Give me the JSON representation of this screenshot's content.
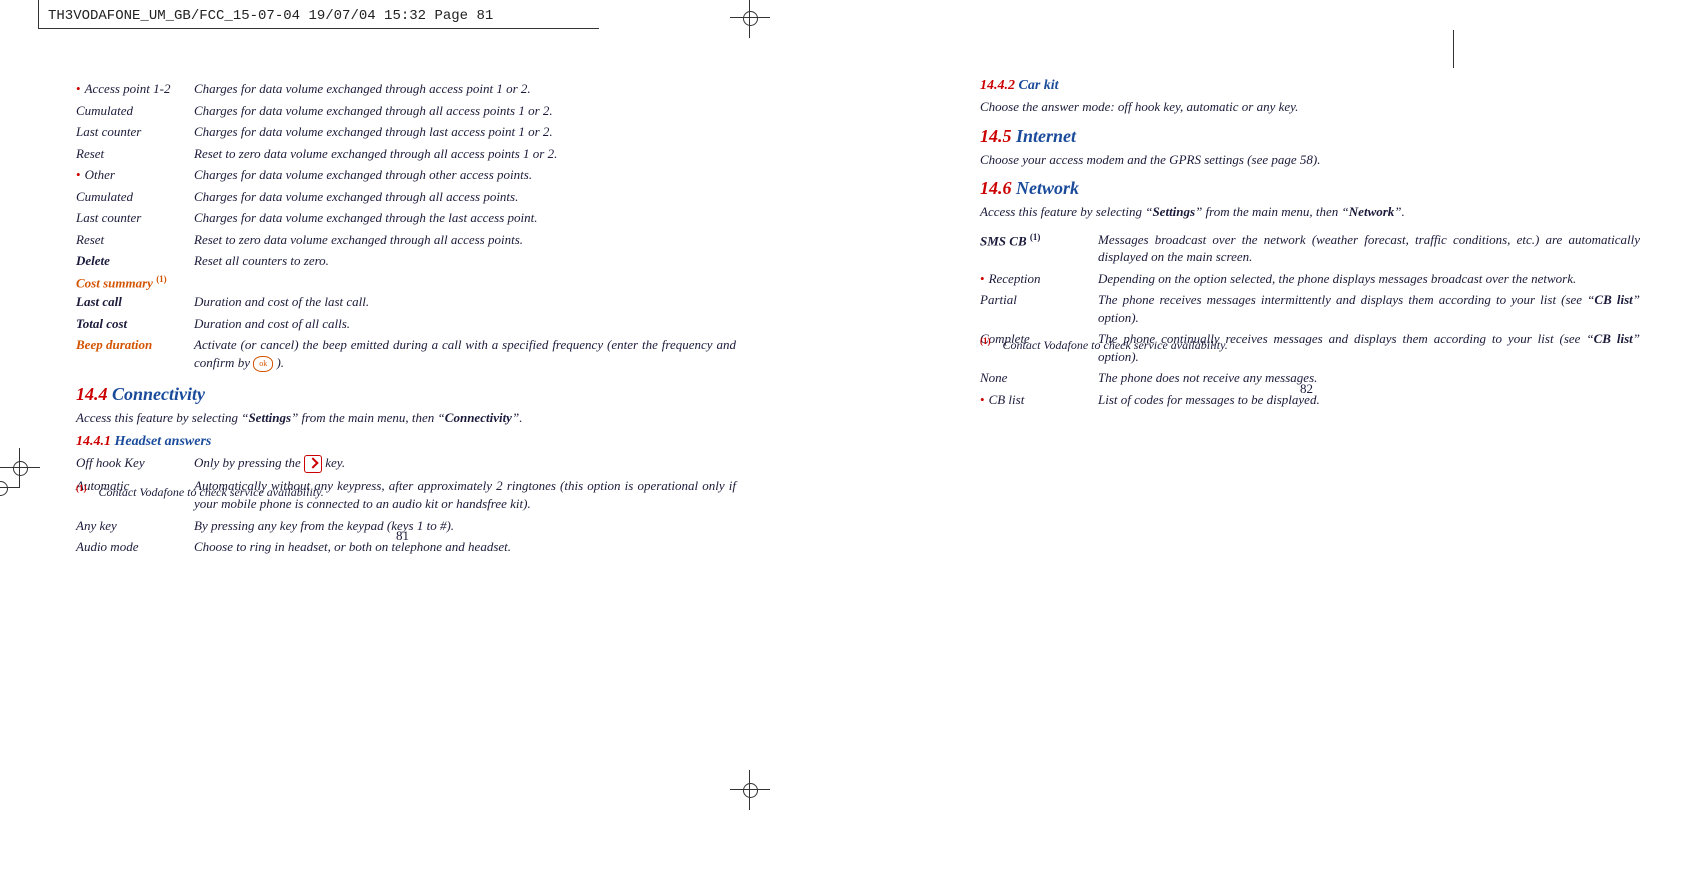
{
  "header": {
    "slug": "TH3VODAFONE_UM_GB/FCC_15-07-04   19/07/04   15:32   Page 81"
  },
  "left": {
    "rows": [
      {
        "term": "Access point 1-2",
        "bullet": true,
        "indent": 0,
        "desc": "Charges for data volume exchanged through access point 1 or 2."
      },
      {
        "term": "Cumulated",
        "bullet": false,
        "indent": 1,
        "desc": "Charges for data volume exchanged through all access points 1 or 2."
      },
      {
        "term": "Last counter",
        "bullet": false,
        "indent": 1,
        "desc": "Charges for data volume exchanged through last access point 1 or 2."
      },
      {
        "term": "Reset",
        "bullet": false,
        "indent": 1,
        "desc": "Reset to zero data volume exchanged through all access points 1 or 2."
      },
      {
        "term": "Other",
        "bullet": true,
        "indent": 0,
        "desc": "Charges for data volume exchanged through other access points."
      },
      {
        "term": "Cumulated",
        "bullet": false,
        "indent": 1,
        "desc": "Charges for data volume exchanged through all access points."
      },
      {
        "term": "Last counter",
        "bullet": false,
        "indent": 1,
        "desc": "Charges for data volume exchanged through the last access point."
      },
      {
        "term": "Reset",
        "bullet": false,
        "indent": 1,
        "desc": "Reset to zero data volume exchanged through all access points."
      },
      {
        "term": "Delete",
        "bold": true,
        "bullet": false,
        "indent": 0,
        "desc": "Reset all counters to zero."
      }
    ],
    "cost_heading": "Cost summary ",
    "cost_fn": "(1)",
    "cost": [
      {
        "term": "Last call",
        "desc": "Duration and cost of the last call."
      },
      {
        "term": "Total cost",
        "desc": "Duration and cost of all calls."
      }
    ],
    "beep_term": "Beep duration",
    "beep_desc_a": "Activate (or cancel) the beep emitted during a call with a specified frequency (enter the frequency and confirm by ",
    "beep_desc_b": " ).",
    "h144_num": "14.4 ",
    "h144_txt": "Connectivity",
    "p144_a": "Access this feature by selecting “",
    "p144_b": "Settings",
    "p144_c": "” from the main menu, then “",
    "p144_d": "Connectivity",
    "p144_e": "”.",
    "h1441_num": "14.4.1   ",
    "h1441_txt": "Headset answers",
    "headset": [
      {
        "term": "Off hook Key",
        "desc_a": "Only by pressing the ",
        "desc_b": " key.",
        "icon": "key"
      },
      {
        "term": "Automatic",
        "desc": "Automatically without any keypress, after approximately 2 ringtones (this option is operational only if your mobile phone is connected to an audio kit or handsfree kit)."
      },
      {
        "term": "Any key",
        "desc": "By pressing any key from the keypad (keys 1 to #)."
      },
      {
        "term": "Audio mode",
        "desc": "Choose to ring in headset, or both on telephone and headset."
      }
    ],
    "footnote_mark": "(1)",
    "footnote": "Contact Vodafone to check service availability.",
    "pagenum": "81"
  },
  "right": {
    "h1442_num": "14.4.2   ",
    "h1442_txt": "Car kit",
    "p1442": "Choose the answer mode: off hook key, automatic or any key.",
    "h145_num": "14.5 ",
    "h145_txt": "Internet",
    "p145": "Choose your access modem and the GPRS settings (see page 58).",
    "h146_num": "14.6 ",
    "h146_txt": "Network",
    "p146_a": "Access this feature by selecting “",
    "p146_b": "Settings",
    "p146_c": "” from the main menu, then “",
    "p146_d": "Network",
    "p146_e": "”.",
    "rows": [
      {
        "term": "SMS CB ",
        "fn": "(1)",
        "bold": true,
        "bullet": false,
        "indent": 0,
        "desc": "Messages broadcast over the network (weather forecast, traffic conditions, etc.) are automatically displayed on the main screen."
      },
      {
        "term": "Reception",
        "bullet": true,
        "indent": 0,
        "desc": "Depending on the option selected, the phone displays messages broadcast over the network."
      },
      {
        "term": "Partial",
        "bullet": false,
        "indent": 1,
        "desc_a": "The phone receives messages intermittently and displays them according to your list (see “",
        "desc_bold": "CB list",
        "desc_b": "” option)."
      },
      {
        "term": "Complete",
        "bullet": false,
        "indent": 1,
        "desc_a": "The phone continually receives messages and displays them according to your list (see “",
        "desc_bold": "CB list",
        "desc_b": "” option)."
      },
      {
        "term": "None",
        "bullet": false,
        "indent": 1,
        "desc": "The phone does not receive any messages."
      },
      {
        "term": "CB list",
        "bullet": true,
        "indent": 0,
        "desc": "List of codes for messages to be displayed."
      }
    ],
    "footnote_mark": "(1)",
    "footnote": "Contact Vodafone to check service availability.",
    "pagenum": "82"
  }
}
